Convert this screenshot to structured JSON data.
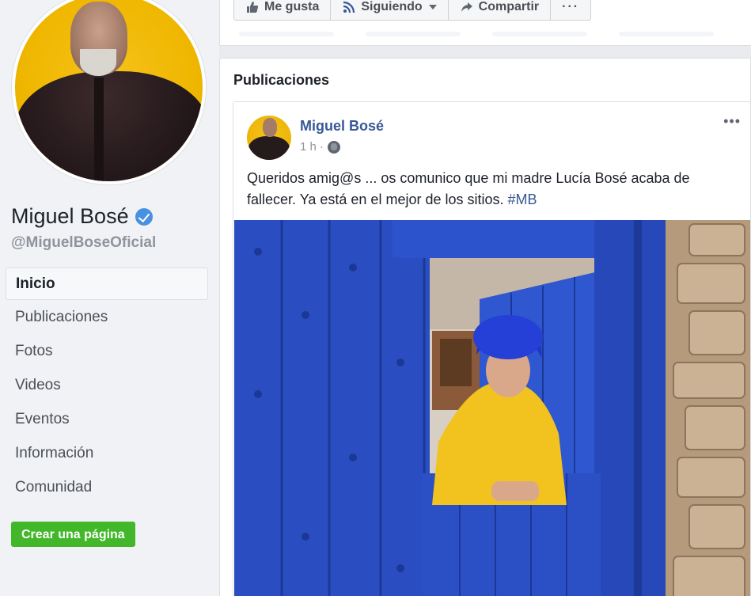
{
  "sidebar": {
    "page_name": "Miguel Bosé",
    "page_handle": "@MiguelBoseOficial",
    "nav": [
      {
        "label": "Inicio",
        "active": true
      },
      {
        "label": "Publicaciones",
        "active": false
      },
      {
        "label": "Fotos",
        "active": false
      },
      {
        "label": "Videos",
        "active": false
      },
      {
        "label": "Eventos",
        "active": false
      },
      {
        "label": "Información",
        "active": false
      },
      {
        "label": "Comunidad",
        "active": false
      }
    ],
    "create_page_label": "Crear una página"
  },
  "actions": {
    "like": "Me gusta",
    "following": "Siguiendo",
    "share": "Compartir",
    "more": "···"
  },
  "publications": {
    "title": "Publicaciones",
    "post": {
      "author": "Miguel Bosé",
      "time": "1 h",
      "separator": "·",
      "more": "•••",
      "text": "Queridos amig@s ... os comunico que mi madre Lucía Bosé acaba de fallecer. Ya está en el mejor de los sitios.",
      "hashtag": "#MB"
    }
  },
  "colors": {
    "link": "#385898",
    "create_button": "#42b72a",
    "verified": "#4a90e2"
  }
}
